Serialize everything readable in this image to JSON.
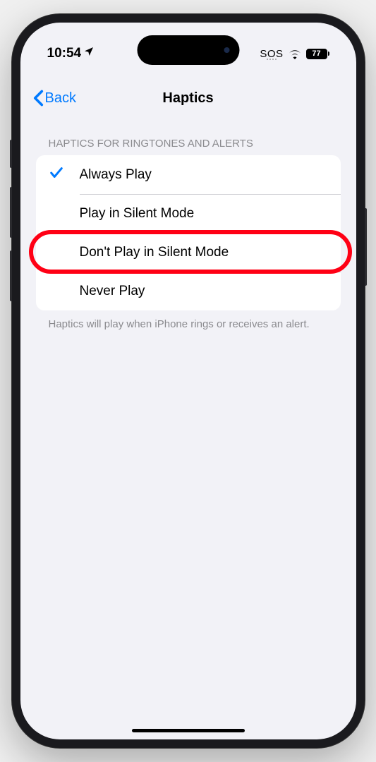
{
  "statusBar": {
    "time": "10:54",
    "sos": "SOS",
    "battery": "77"
  },
  "nav": {
    "back": "Back",
    "title": "Haptics"
  },
  "section": {
    "header": "HAPTICS FOR RINGTONES AND ALERTS",
    "footer": "Haptics will play when iPhone rings or receives an alert."
  },
  "options": {
    "opt0": "Always Play",
    "opt1": "Play in Silent Mode",
    "opt2": "Don't Play in Silent Mode",
    "opt3": "Never Play"
  },
  "selectedIndex": 0,
  "highlightedIndex": 2
}
